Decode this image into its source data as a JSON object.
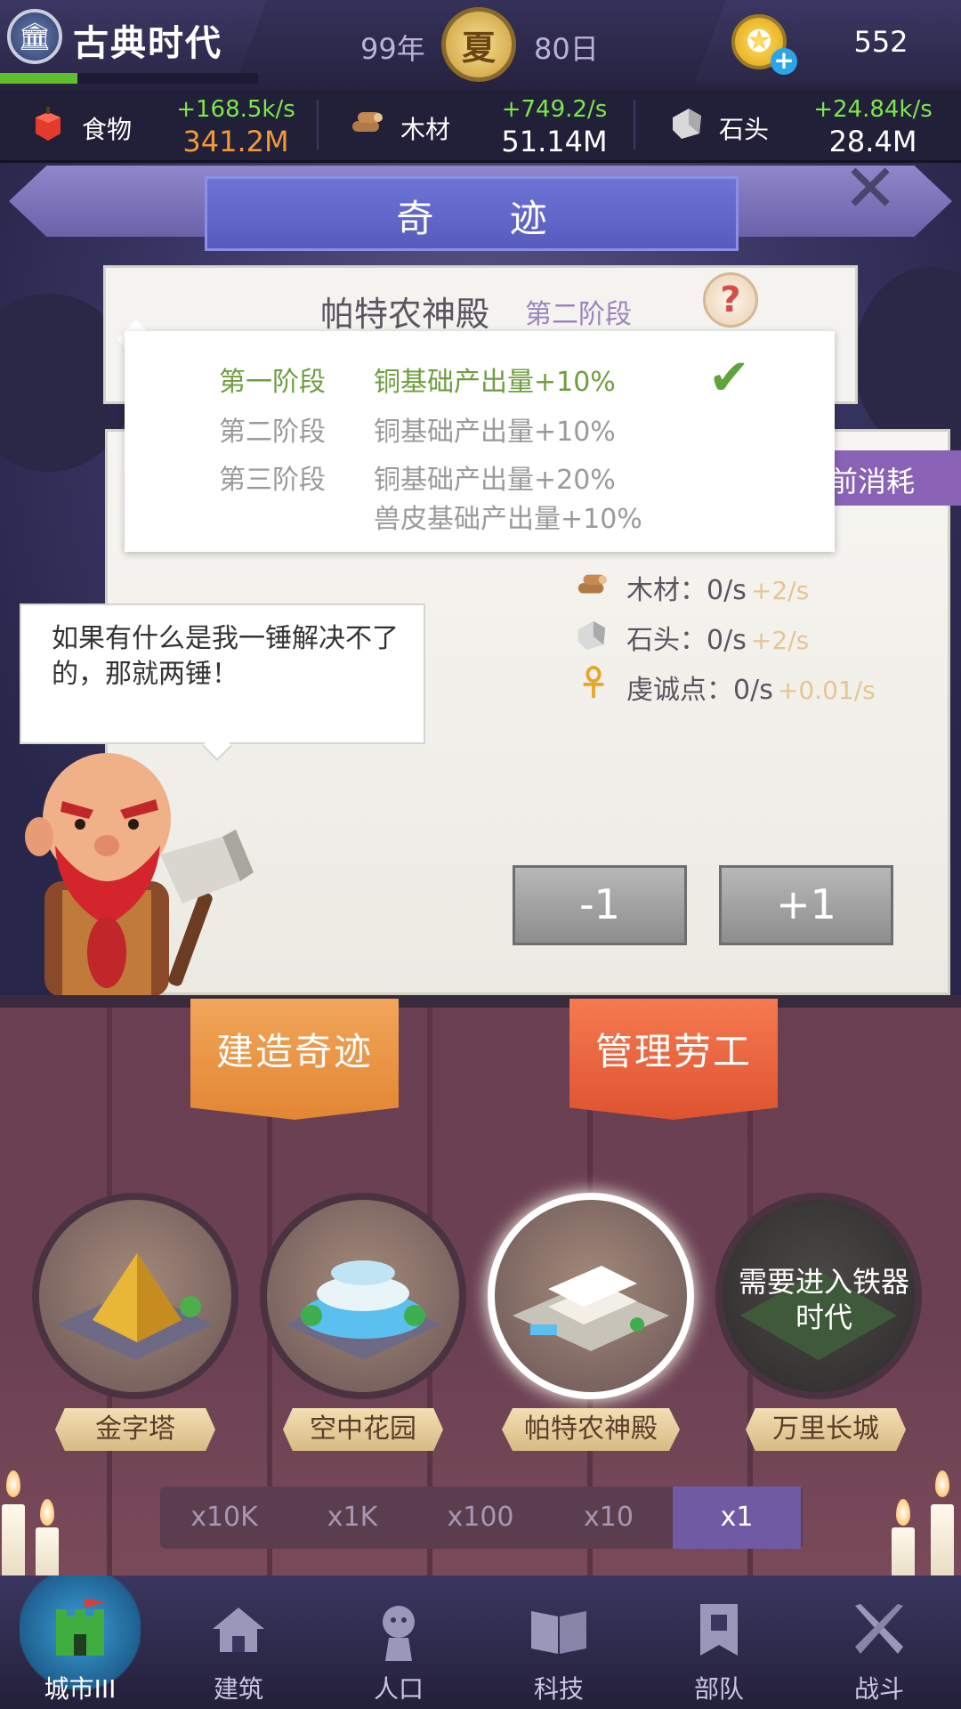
{
  "topbar": {
    "era": "古典时代",
    "era_progress": 0.3,
    "year": "99年",
    "season": "夏",
    "day": "80日",
    "gold": "552"
  },
  "resources": [
    {
      "name": "食物",
      "rate": "+168.5k/s",
      "amount": "341.2M",
      "amount_color": "#f29a3a",
      "icon": "apple-icon"
    },
    {
      "name": "木材",
      "rate": "+749.2/s",
      "amount": "51.14M",
      "amount_color": "#ffffff",
      "icon": "wood-icon"
    },
    {
      "name": "石头",
      "rate": "+24.84k/s",
      "amount": "28.4M",
      "amount_color": "#ffffff",
      "icon": "stone-icon"
    }
  ],
  "dialog": {
    "title": "奇 迹",
    "wonder_name": "帕特农神殿",
    "wonder_stage": "第二阶段",
    "help": "?",
    "consume_label": "前消耗"
  },
  "stages": [
    {
      "name": "第一阶段",
      "effect": "铜基础产出量+10%",
      "effect2": "",
      "done": true
    },
    {
      "name": "第二阶段",
      "effect": "铜基础产出量+10%",
      "effect2": "",
      "done": false
    },
    {
      "name": "第三阶段",
      "effect": "铜基础产出量+20%",
      "effect2": "兽皮基础产出量+10%",
      "done": false
    }
  ],
  "production": [
    {
      "label": "木材：0/s",
      "bonus": "+2/s",
      "icon": "wood-icon"
    },
    {
      "label": "石头：0/s",
      "bonus": "+2/s",
      "icon": "stone-icon"
    },
    {
      "label": "虔诚点：0/s",
      "bonus": "+0.01/s",
      "icon": "ankh-icon"
    }
  ],
  "speech": "如果有什么是我一锤解决不了的，那就两锤！",
  "buttons": {
    "minus": "-1",
    "plus": "+1"
  },
  "tabs": {
    "build": "建造奇迹",
    "manage": "管理劳工"
  },
  "wonders": [
    {
      "name": "金字塔",
      "state": "normal"
    },
    {
      "name": "空中花园",
      "state": "normal"
    },
    {
      "name": "帕特农神殿",
      "state": "selected"
    },
    {
      "name": "万里长城",
      "state": "locked",
      "locked_text": "需要进入铁器时代"
    }
  ],
  "multipliers": {
    "options": [
      "x10K",
      "x1K",
      "x100",
      "x10",
      "x1"
    ],
    "selected": "x1"
  },
  "nav": [
    {
      "label": "城市III",
      "icon": "castle-icon",
      "active": true
    },
    {
      "label": "建筑",
      "icon": "house-icon",
      "active": false
    },
    {
      "label": "人口",
      "icon": "person-icon",
      "active": false
    },
    {
      "label": "科技",
      "icon": "book-icon",
      "active": false
    },
    {
      "label": "部队",
      "icon": "banner-icon",
      "active": false
    },
    {
      "label": "战斗",
      "icon": "swords-icon",
      "active": false
    }
  ]
}
